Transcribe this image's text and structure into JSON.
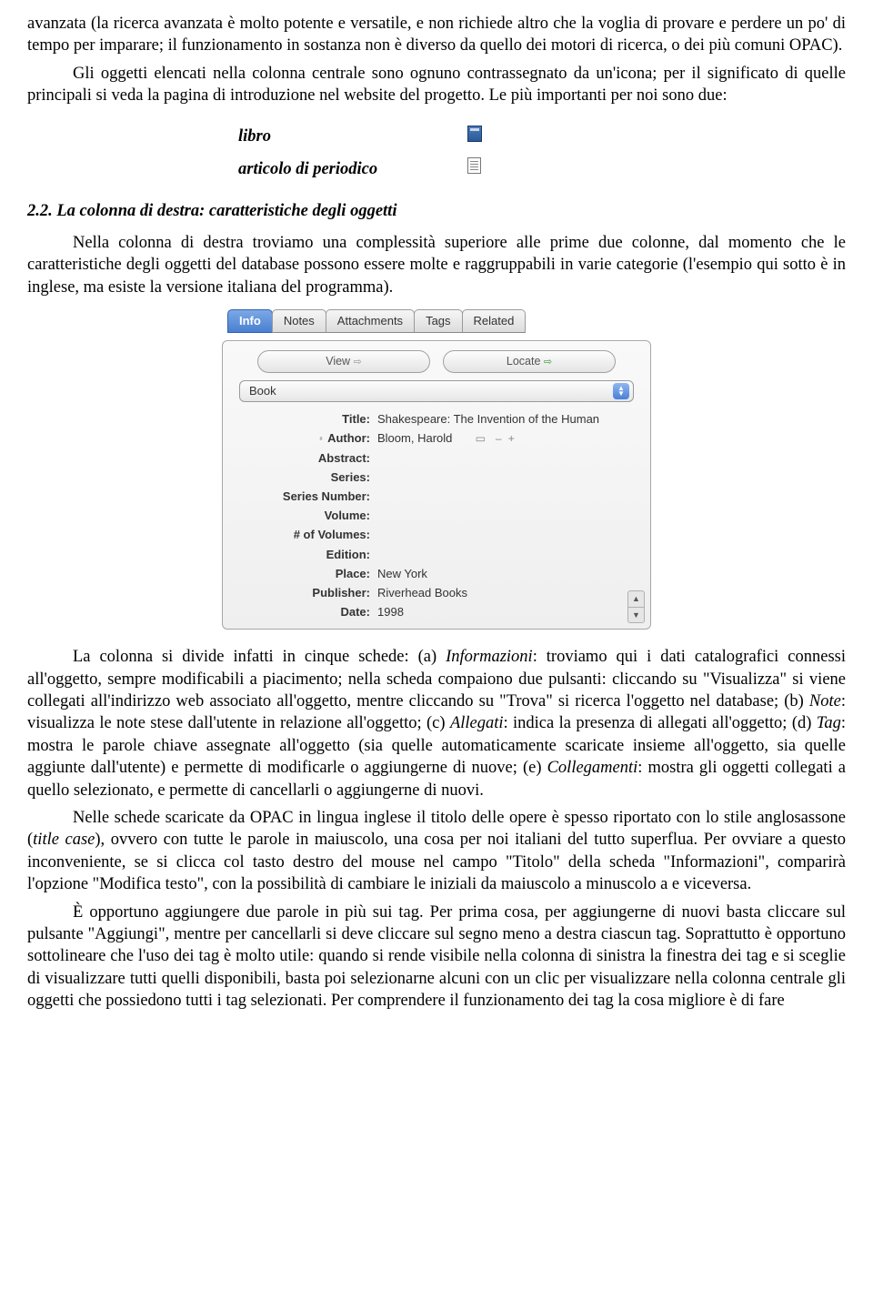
{
  "para1": "avanzata (la ricerca avanzata è molto potente e versatile, e non richiede altro che la voglia di provare e perdere un po' di tempo per imparare; il funzionamento in sostanza non è diverso da quello dei motori di ricerca, o dei più comuni OPAC).",
  "para2a": "Gli oggetti elencati nella colonna centrale sono ognuno contrassegnato da un'icona; per il significato di quelle principali si veda la pagina di introduzione nel website del progetto. Le più importanti per noi sono due:",
  "icons": {
    "book": "libro",
    "article": "articolo di periodico"
  },
  "section22": "2.2. La colonna di destra: caratteristiche degli oggetti",
  "para3": "Nella colonna di destra troviamo una complessità superiore alle prime due colonne, dal momento che le caratteristiche degli oggetti del database possono essere molte e raggruppabili in varie categorie (l'esempio qui sotto è in inglese, ma esiste la versione italiana del programma).",
  "panel": {
    "tabs": [
      "Info",
      "Notes",
      "Attachments",
      "Tags",
      "Related"
    ],
    "view": "View",
    "locate": "Locate",
    "type": "Book",
    "fields": [
      {
        "k": "Title:",
        "v": "Shakespeare: The Invention of the Human"
      },
      {
        "k": "Author:",
        "v": "Bloom,  Harold"
      },
      {
        "k": "Abstract:",
        "v": ""
      },
      {
        "k": "Series:",
        "v": ""
      },
      {
        "k": "Series Number:",
        "v": ""
      },
      {
        "k": "Volume:",
        "v": ""
      },
      {
        "k": "# of Volumes:",
        "v": ""
      },
      {
        "k": "Edition:",
        "v": ""
      },
      {
        "k": "Place:",
        "v": "New York"
      },
      {
        "k": "Publisher:",
        "v": "Riverhead Books"
      },
      {
        "k": "Date:",
        "v": "1998"
      }
    ]
  },
  "para4_pre": "La colonna si divide infatti in cinque schede: (a) ",
  "para4_i1": "Informazioni",
  "para4_mid1": ": troviamo qui i dati catalografici connessi all'oggetto, sempre modificabili a piacimento; nella scheda compaiono due pulsanti: cliccando su \"Visualizza\" si viene collegati all'indirizzo web associato all'oggetto, mentre cliccando su \"Trova\" si ricerca l'oggetto nel database; (b) ",
  "para4_i2": "Note",
  "para4_mid2": ": visualizza le note stese dall'utente in relazione all'oggetto; (c) ",
  "para4_i3": "Allegati",
  "para4_mid3": ": indica la presenza di allegati all'oggetto; (d) ",
  "para4_i4": "Tag",
  "para4_mid4": ": mostra le parole chiave assegnate all'oggetto (sia quelle automaticamente scaricate insieme all'oggetto, sia quelle aggiunte dall'utente) e permette di modificarle o aggiungerne di nuove; (e) ",
  "para4_i5": "Collegamenti",
  "para4_end": ": mostra gli oggetti collegati a quello selezionato, e permette di cancellarli o aggiungerne di nuovi.",
  "para5_pre": "Nelle schede scaricate da OPAC in lingua inglese il titolo delle opere è spesso riportato con lo stile anglosassone (",
  "para5_i": "title case",
  "para5_end": "), ovvero con tutte le parole in maiuscolo, una cosa per noi italiani del tutto superflua. Per ovviare a questo inconveniente, se si clicca col tasto destro del mouse nel campo \"Titolo\" della scheda \"Informazioni\", comparirà l'opzione \"Modifica testo\", con la possibilità di cambiare le iniziali da maiuscolo a minuscolo a e viceversa.",
  "para6": "È opportuno aggiungere due parole in più sui tag. Per prima cosa, per aggiungerne di nuovi basta cliccare sul pulsante \"Aggiungi\", mentre per cancellarli si deve cliccare sul segno meno a destra ciascun tag. Soprattutto è opportuno sottolineare che l'uso dei tag è molto utile: quando si rende visibile nella colonna di sinistra la finestra dei tag e si sceglie di visualizzare tutti quelli disponibili, basta poi selezionarne alcuni con un clic per visualizzare nella colonna centrale gli oggetti che possiedono tutti i tag selezionati. Per comprendere il funzionamento dei tag la cosa migliore è di fare"
}
